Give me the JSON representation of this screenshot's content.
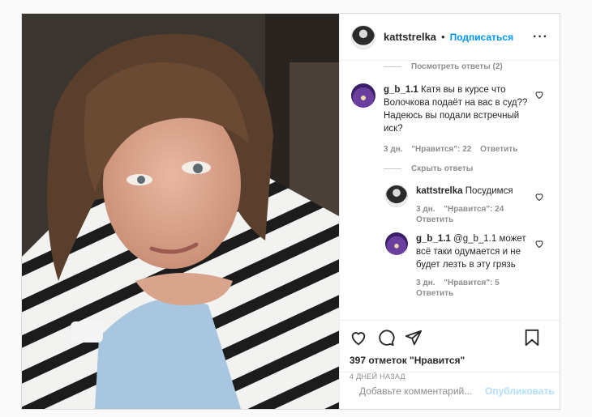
{
  "header": {
    "username": "kattstrelka",
    "separator": "•",
    "follow_label": "Подписаться",
    "more_label": "···"
  },
  "comments": {
    "view_replies_top": "Посмотреть ответы (2)",
    "hide_replies": "Скрыть ответы",
    "main": {
      "username": "g_b_1.1",
      "text": "Катя вы в курсе что Волочкова подаёт на вас в суд?? Надеюсь вы подали встречный иск?",
      "age": "3 дн.",
      "likes": "\"Нравится\": 22",
      "reply": "Ответить"
    },
    "replies": [
      {
        "username": "kattstrelka",
        "text": "Посудимся",
        "age": "3 дн.",
        "likes": "\"Нравится\": 24",
        "reply": "Ответить"
      },
      {
        "username": "g_b_1.1",
        "mention": "@g_b_1.1",
        "text": "может всё таки одумается и не будет лезть в эту грязь",
        "age": "3 дн.",
        "likes": "\"Нравится\": 5",
        "reply": "Ответить"
      }
    ]
  },
  "actions": {
    "likes_count": "397 отметок \"Нравится\"",
    "time_ago": "4 ДНЕЙ НАЗАД"
  },
  "add_comment": {
    "placeholder": "Добавьте комментарий...",
    "publish_label": "Опубликовать"
  },
  "colors": {
    "link": "#0095f6",
    "publish_disabled": "#b2dffc",
    "muted": "#8e8e8e"
  },
  "icons": [
    "heart-icon",
    "comment-icon",
    "share-icon",
    "bookmark-icon",
    "emoji-icon",
    "more-icon"
  ]
}
